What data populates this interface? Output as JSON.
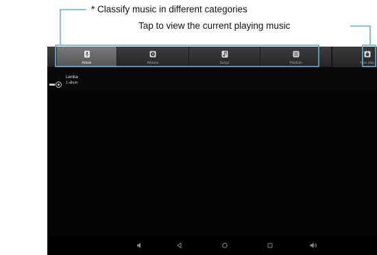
{
  "annotations": {
    "categories_text": "* Classify music in different categories",
    "now_playing_text": "Tap to view the current playing music"
  },
  "tabs": [
    {
      "label": "Artists",
      "icon": "artist-icon",
      "selected": true
    },
    {
      "label": "Albums",
      "icon": "album-icon",
      "selected": false
    },
    {
      "label": "Songs",
      "icon": "song-icon",
      "selected": false
    },
    {
      "label": "Playlists",
      "icon": "playlist-icon",
      "selected": false
    },
    {
      "label": "Now play",
      "icon": "now-playing-icon",
      "selected": false
    }
  ],
  "artist_list": [
    {
      "name": "Lenka",
      "count": "1 album"
    }
  ],
  "navbar": {
    "icons": [
      "volume-down-icon",
      "back-icon",
      "home-icon",
      "recent-apps-icon",
      "volume-up-icon"
    ]
  },
  "colors": {
    "annotation_outline": "#5ab3e0",
    "tabbar": "#2e2e2e",
    "tab_selected": "#666666",
    "screen_background": "#080808"
  }
}
